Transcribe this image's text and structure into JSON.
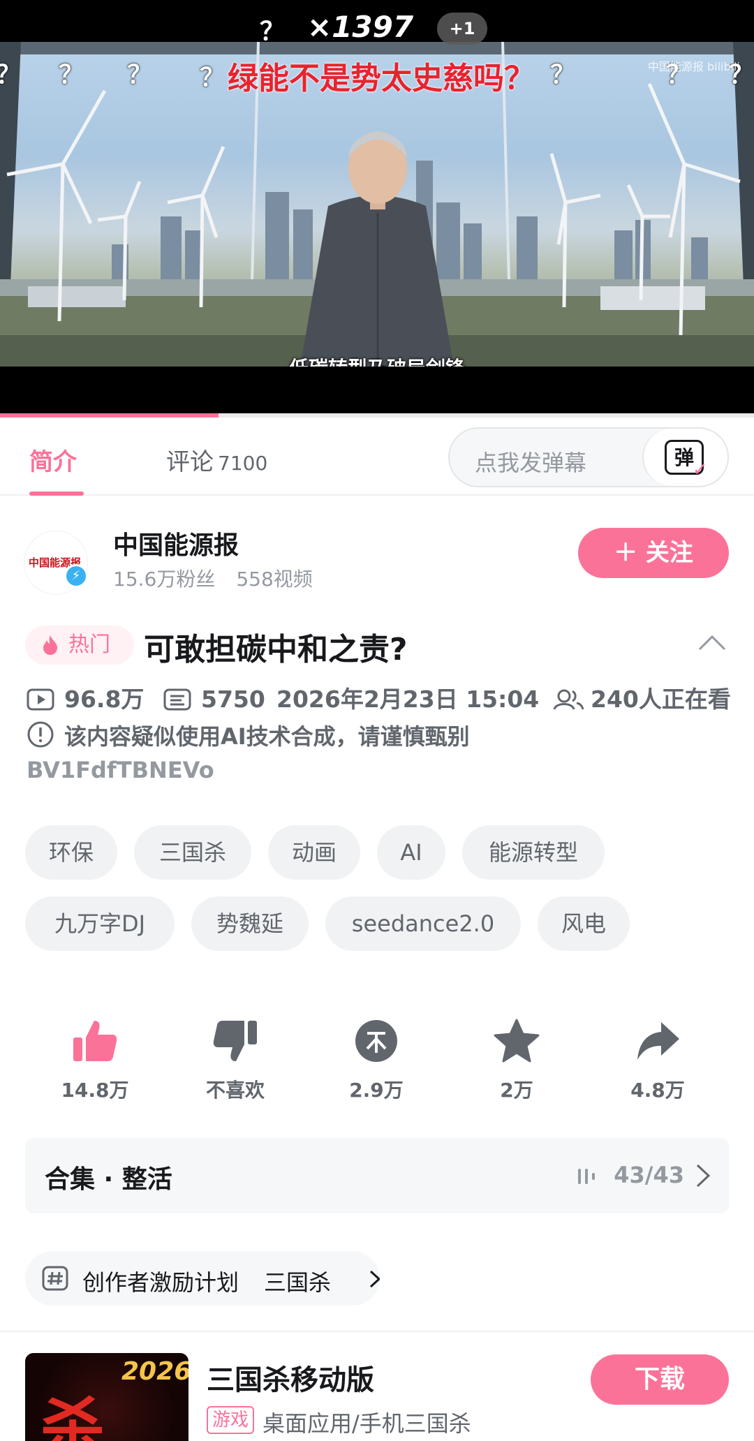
{
  "player": {
    "danmaku_count": "×1397",
    "plus_badge": "+1",
    "overlay_title": "绿能不是势太史慈吗？",
    "question_mark": "？",
    "subtitle": "低碳转型乃破局剑锋",
    "watermark": "中国能源报 bilibili",
    "progress": 0.29
  },
  "tabs": {
    "intro": "简介",
    "comments": "评论",
    "comments_count": "7100",
    "danmaku_placeholder": "点我发弹幕",
    "danmaku_button": "弹"
  },
  "uploader": {
    "logo_text": "中国能源报",
    "name": "中国能源报",
    "fans": "15.6万粉丝",
    "videos": "558视频",
    "follow": "＋ 关注"
  },
  "video": {
    "hot_badge": "热门",
    "title": "可敢担碳中和之责?",
    "views": "96.8万",
    "danmaku": "5750",
    "date": "2026年2月23日 15:04",
    "watching": "240人正在看",
    "ai_notice": "该内容疑似使用AI技术合成，请谨慎甄别",
    "bvid": "BV1FdfTBNEVo"
  },
  "tags": [
    "环保",
    "三国杀",
    "动画",
    "AI",
    "能源转型",
    "九万字DJ",
    "势魏延",
    "seedance2.0",
    "风电"
  ],
  "actions": {
    "like": "14.8万",
    "dislike": "不喜欢",
    "coin": "2.9万",
    "favorite": "2万",
    "share": "4.8万"
  },
  "collection": {
    "title": "合集 · 整活",
    "count": "43/43"
  },
  "topics": [
    "创作者激励计划",
    "三国杀"
  ],
  "ad": {
    "year": "2026",
    "cover_char": "杀",
    "name": "三国杀移动版",
    "tag": "游戏",
    "desc": "桌面应用/手机三国杀",
    "download": "下载"
  },
  "colors": {
    "accent": "#fb7299",
    "text_primary": "#18191c",
    "text_secondary": "#61666d",
    "text_tertiary": "#9499a0"
  }
}
